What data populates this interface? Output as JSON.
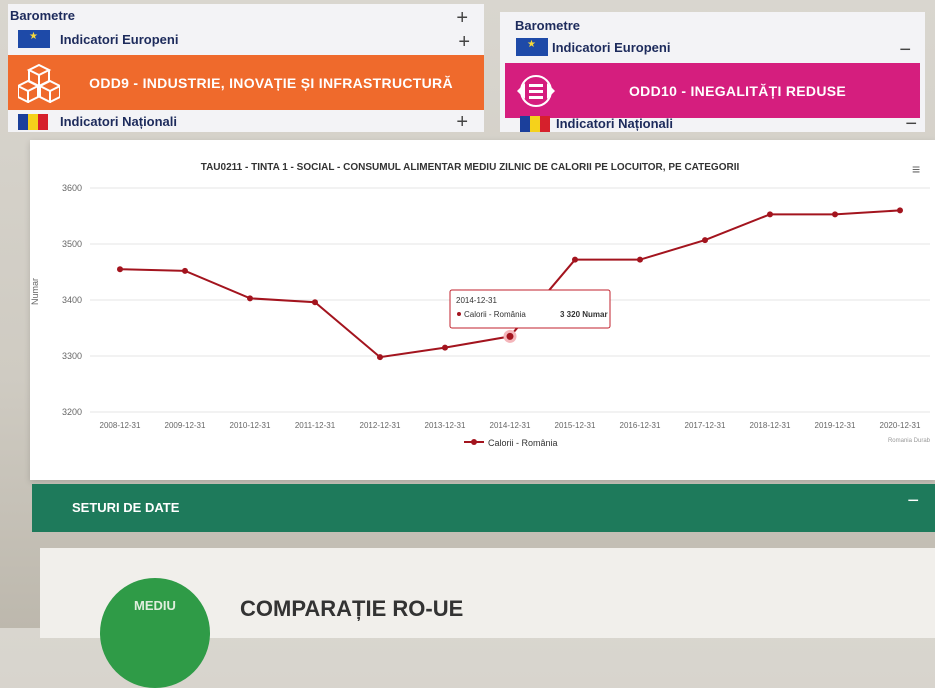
{
  "left_panel": {
    "barometre": "Barometre",
    "eu_indicators": "Indicatori Europeni",
    "odd_title": "ODD9 - INDUSTRIE, INOVAȚIE ȘI INFRASTRUCTURĂ",
    "national_indicators": "Indicatori Naționali",
    "accent": "#ef6a2c"
  },
  "right_panel": {
    "barometre": "Barometre",
    "eu_indicators": "Indicatori Europeni",
    "odd_title": "ODD10 - INEGALITĂȚI REDUSE",
    "national_indicators": "Indicatori Naționali",
    "accent": "#d51e7e"
  },
  "icons": {
    "plus": "+",
    "minus": "−",
    "menu": "≡"
  },
  "chart_data": {
    "type": "line",
    "title": "TAU0211 - TINTA 1 - SOCIAL - CONSUMUL ALIMENTAR MEDIU ZILNIC DE CALORII PE LOCUITOR, PE CATEGORII",
    "ylabel": "Numar",
    "xlabel": "",
    "ylim": [
      3200,
      3600
    ],
    "yticks": [
      3200,
      3300,
      3400,
      3500,
      3600
    ],
    "categories": [
      "2008-12-31",
      "2009-12-31",
      "2010-12-31",
      "2011-12-31",
      "2012-12-31",
      "2013-12-31",
      "2014-12-31",
      "2015-12-31",
      "2016-12-31",
      "2017-12-31",
      "2018-12-31",
      "2019-12-31",
      "2020-12-31"
    ],
    "series": [
      {
        "name": "Calorii - România",
        "color": "#a3141e",
        "values": [
          3455,
          3452,
          3403,
          3396,
          3298,
          3315,
          3335,
          3472,
          3472,
          3507,
          3553,
          3553,
          3560
        ]
      }
    ],
    "legend": "bottom-center",
    "grid": true,
    "tooltip": {
      "date": "2014-12-31",
      "label": "Calorii - România",
      "value": "3 320 Numar"
    },
    "credit": "Romania Durab"
  },
  "footer": {
    "label": "SETURI DE DATE"
  },
  "bottom": {
    "badge": "MEDIU",
    "title": "COMPARAȚIE RO-UE"
  }
}
